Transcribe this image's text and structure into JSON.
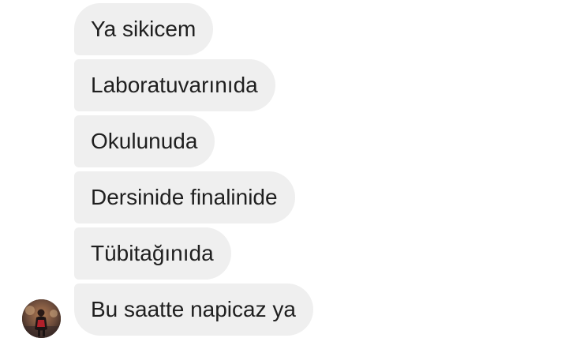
{
  "messages": [
    {
      "text": "Ya sikicem"
    },
    {
      "text": "Laboratuvarınıda"
    },
    {
      "text": "Okulunuda"
    },
    {
      "text": "Dersinide finalinide"
    },
    {
      "text": "Tübitağınıda"
    },
    {
      "text": "Bu saatte napicaz ya"
    }
  ],
  "colors": {
    "bubble_bg": "#efefef",
    "text": "#1f1f1f",
    "background": "#ffffff"
  },
  "icons": {
    "avatar": "sender-avatar-photo"
  }
}
